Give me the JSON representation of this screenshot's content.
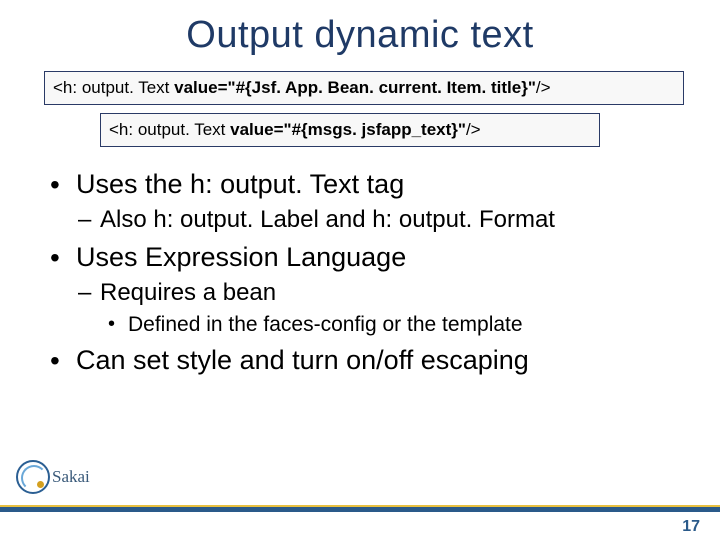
{
  "title": "Output dynamic text",
  "code1": {
    "prefix": "<h: output. Text ",
    "attr": "value=\"#{Jsf. App. Bean. current. Item. title}\"",
    "suffix": "/>"
  },
  "code2": {
    "prefix": "<h: output. Text ",
    "attr": "value=\"#{msgs. jsfapp_text}\"",
    "suffix": "/>"
  },
  "bullets": {
    "b1a": "Uses the h: output. Text tag",
    "b2a": "Also h: output. Label and h: output. Format",
    "b1b": "Uses Expression Language",
    "b2b": "Requires a bean",
    "b3a": "Defined in the faces-config or the template",
    "b1c": "Can set style and turn on/off escaping"
  },
  "logo_text": "Sakai",
  "page_number": "17"
}
